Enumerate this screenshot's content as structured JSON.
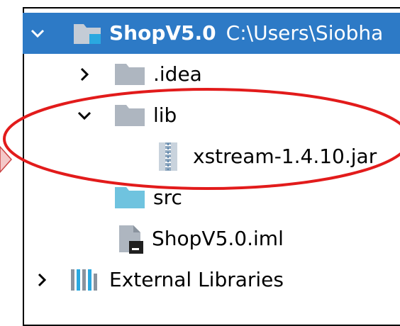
{
  "project": {
    "name": "ShopV5.0",
    "path": "C:\\Users\\Siobha"
  },
  "tree": {
    "idea": ".idea",
    "lib": "lib",
    "jar": "xstream-1.4.10.jar",
    "src": "src",
    "iml": "ShopV5.0.iml",
    "external": "External Libraries"
  },
  "icons": {
    "folder": "folder-icon",
    "module": "module-folder-icon",
    "archive": "jar-archive-icon",
    "iml": "iml-file-icon",
    "libraries": "libraries-icon",
    "expand": "chevron-down-icon",
    "collapsed": "chevron-right-icon"
  },
  "colors": {
    "selection": "#2d7ac6",
    "folder": "#aeb6c0",
    "source_folder": "#6fc3df",
    "highlight_ellipse": "#e21b1b"
  }
}
